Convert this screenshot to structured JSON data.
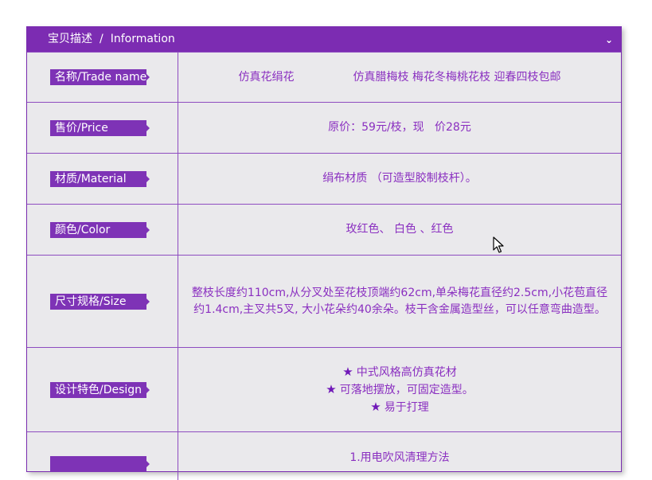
{
  "header": {
    "title_cn": "宝贝描述",
    "separator": "/",
    "title_en": "Information",
    "chevron_icon": "chevron-down-icon"
  },
  "rows": [
    {
      "label": "名称/Trade name",
      "value_a": "仿真花绢花",
      "value_b": "仿真腊梅枝 梅花冬梅桃花枝 迎春四枝包邮"
    },
    {
      "label": "售价/Price",
      "value": "原价：59元/枝，现   价28元"
    },
    {
      "label": "材质/Material",
      "value": "绢布材质 （可造型胶制枝杆）。"
    },
    {
      "label": "颜色/Color",
      "value": "玫红色、 白色 、红色"
    },
    {
      "label": "尺寸规格/Size",
      "value": "整枝长度约110cm,从分叉处至花枝顶端约62cm,单朵梅花直径约2.5cm,小花苞直径约1.4cm,主叉共5叉, 大小花朵约40余朵。枝干含金属造型丝，可以任意弯曲造型。"
    },
    {
      "label": "设计特色/Design",
      "lines": [
        "中式风格高仿真花材",
        "可落地摆放，可固定造型。",
        "易于打理"
      ],
      "bullet_icon": "star-icon"
    },
    {
      "label": "",
      "value": "1.用电吹风清理方法"
    }
  ],
  "colors": {
    "accent": "#7c2cb2",
    "value_text": "#8a2fc0",
    "panel_bg": "#eae9ec"
  }
}
